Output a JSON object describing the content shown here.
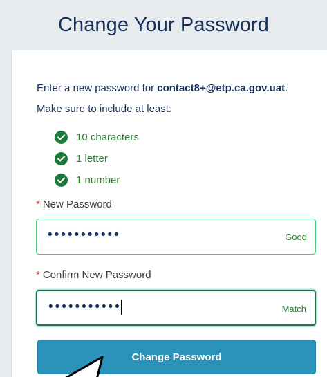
{
  "header": {
    "title": "Change Your Password"
  },
  "intro": {
    "prefix": "Enter a new password for ",
    "email": "contact8+@etp.ca.gov.uat",
    "suffix": ".",
    "line2": "Make sure to include at least:"
  },
  "requirements": [
    {
      "label": "10 characters",
      "met": true
    },
    {
      "label": "1 letter",
      "met": true
    },
    {
      "label": "1 number",
      "met": true
    }
  ],
  "new_password": {
    "star": "*",
    "label": "New Password",
    "value_mask": "•••••••••••",
    "status": "Good"
  },
  "confirm_password": {
    "star": "*",
    "label": "Confirm New Password",
    "value_mask": "•••••••••••",
    "status": "Match"
  },
  "submit": {
    "label": "Change Password"
  },
  "colors": {
    "brand_button": "#2b93b9",
    "success": "#1b7a3a",
    "title": "#16325c",
    "required": "#c23934"
  },
  "icons": {
    "requirement": "check-circle-icon",
    "pointer": "mouse-pointer-icon"
  }
}
